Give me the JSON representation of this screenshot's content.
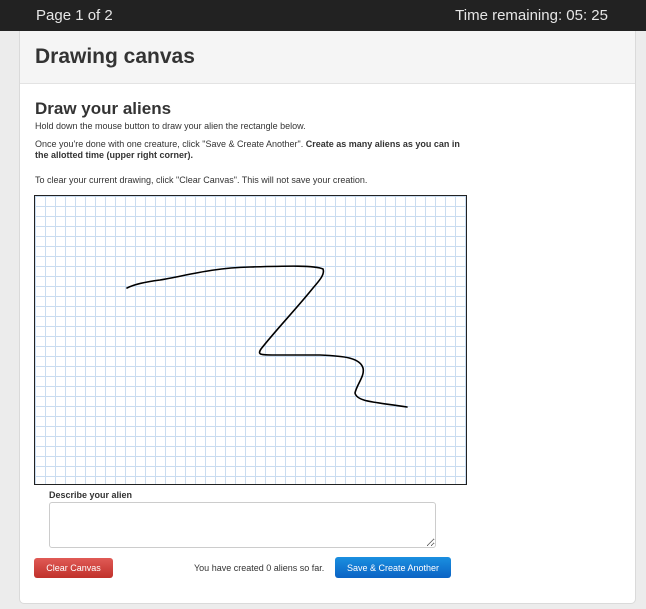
{
  "topbar": {
    "page_indicator": "Page 1 of 2",
    "time_remaining": "Time remaining: 05: 25"
  },
  "header": {
    "title": "Drawing canvas"
  },
  "instructions": {
    "heading": "Draw your aliens",
    "line1": "Hold down the mouse button to draw your alien the rectangle below.",
    "line2_normal": "Once you're done with one creature, click \"Save & Create Another\". ",
    "line2_bold": "Create as many aliens as you can in the allotted time (upper right corner).",
    "line3": "To clear your current drawing, click \"Clear Canvas\". This will not save your creation."
  },
  "description": {
    "label": "Describe your alien",
    "value": "",
    "placeholder": ""
  },
  "footer": {
    "clear_label": "Clear Canvas",
    "status_text": "You have created 0 aliens so far.",
    "save_label": "Save & Create Another"
  },
  "colors": {
    "clear_button": "#d9534f",
    "save_button": "#0e72cf",
    "grid_line": "#c9dcf0",
    "topbar": "#222222"
  }
}
